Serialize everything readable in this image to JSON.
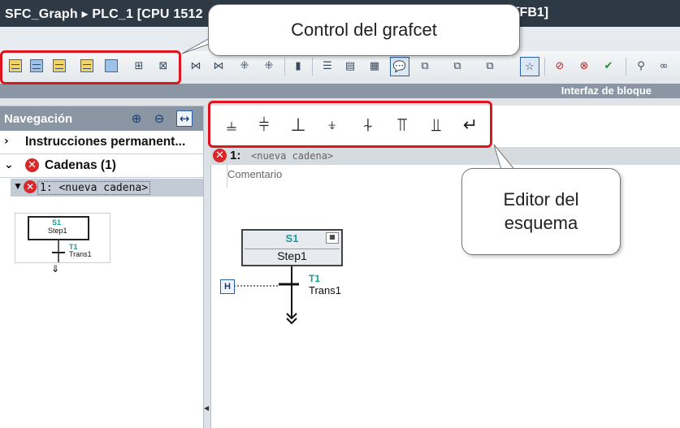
{
  "title_bar": {
    "path": "SFC_Graph  ▸  PLC_1 [CPU 1512",
    "suffix": "h [FB1]"
  },
  "toolbar": {
    "callout": "Control del grafcet",
    "block_interface": "Interfaz de bloque",
    "icons": [
      "step-view-icon",
      "single-step-view-icon",
      "navigation-view-icon",
      "alarm-view-icon",
      "message-view-icon",
      "insert-step-icon",
      "delete-element-icon"
    ]
  },
  "navigation": {
    "title": "Navegación",
    "items": [
      {
        "label": "Instrucciones permanent..."
      },
      {
        "label": "Cadenas (1)"
      }
    ],
    "selected_chain": "1: <nueva cadena>",
    "thumb_step": "S1",
    "thumb_step_name": "Step1",
    "thumb_trans": "T1",
    "thumb_trans_name": "Trans1"
  },
  "editor": {
    "callout": "Editor del esquema",
    "chain_number": "1:",
    "chain_name": "<nueva cadena>",
    "comment": "Comentario",
    "step_id": "S1",
    "step_name": "Step1",
    "trans_id": "T1",
    "trans_name": "Trans1",
    "tools": [
      "step-transition-icon",
      "step-icon",
      "transition-icon",
      "jump-icon",
      "branch-s-icon",
      "simultaneous-branch-icon",
      "alternative-branch-icon",
      "return-icon"
    ]
  },
  "colors": {
    "highlight": "#e0141e",
    "error": "#d8282b",
    "teal_label": "#1a9a9a"
  }
}
